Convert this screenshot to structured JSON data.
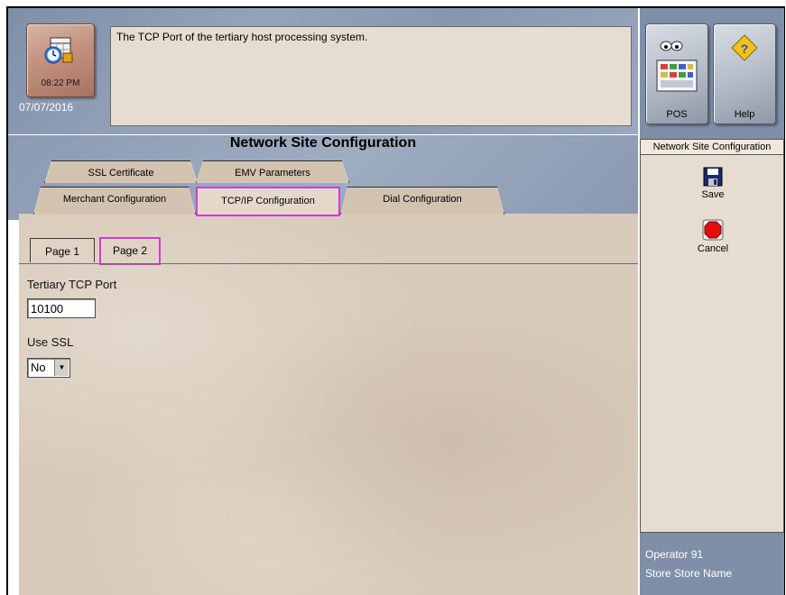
{
  "clock": {
    "time": "08:22 PM",
    "date": "07/07/2016",
    "icon": "clock-calendar-icon"
  },
  "message": "The TCP Port of the tertiary host processing system.",
  "top_buttons": {
    "pos_label": "POS",
    "help_label": "Help"
  },
  "page_title": "Network Site Configuration",
  "tabs_row1": [
    {
      "label": "SSL Certificate"
    },
    {
      "label": "EMV Parameters"
    }
  ],
  "tabs_row2": [
    {
      "label": "Merchant Configuration"
    },
    {
      "label": "TCP/IP Configuration",
      "active": true
    },
    {
      "label": "Dial Configuration"
    }
  ],
  "subtabs": [
    {
      "label": "Page 1"
    },
    {
      "label": "Page 2",
      "active": true
    }
  ],
  "form": {
    "tertiary_tcp_port_label": "Tertiary TCP Port",
    "tertiary_tcp_port_value": "10100",
    "use_ssl_label": "Use SSL",
    "use_ssl_value": "No"
  },
  "side_panel": {
    "title": "Network Site Configuration",
    "save_label": "Save",
    "cancel_label": "Cancel"
  },
  "footer": {
    "operator": "Operator 91",
    "store": "Store Store Name"
  },
  "colors": {
    "highlight": "#d23bd6",
    "header_blue": "#8b9ab1",
    "panel_beige": "#d9cbbb",
    "cancel_red": "#e01010"
  }
}
